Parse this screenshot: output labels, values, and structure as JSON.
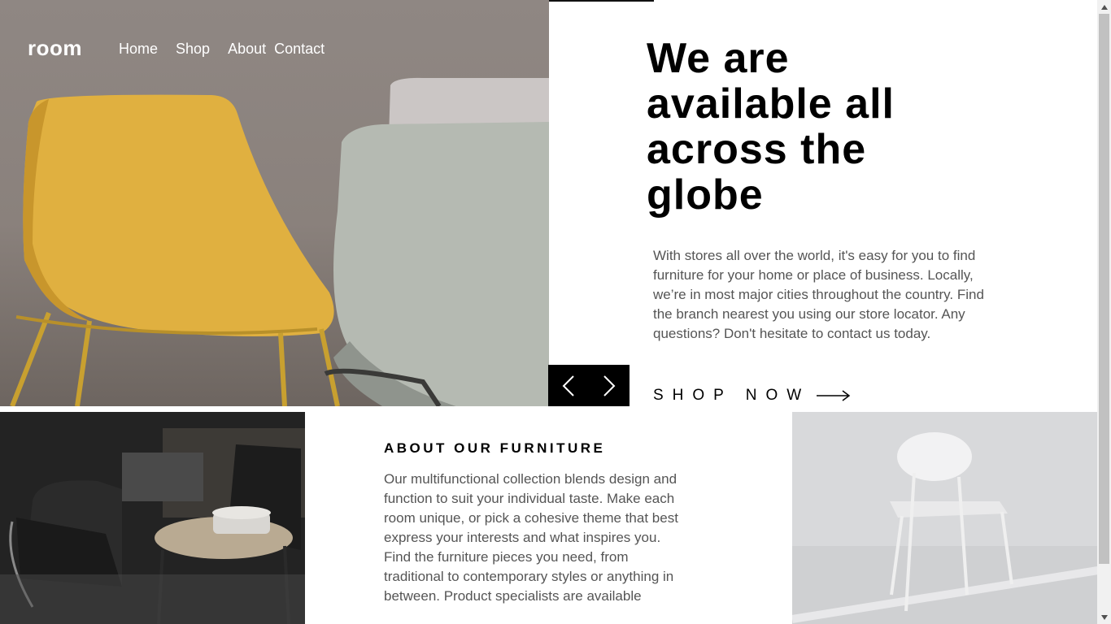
{
  "nav": {
    "logo": "room",
    "links": [
      {
        "label": "Home"
      },
      {
        "label": "Shop"
      },
      {
        "label": "About"
      },
      {
        "label": "Contact"
      }
    ]
  },
  "hero": {
    "title": "We are available all across the globe",
    "description": "With stores all over the world, it's easy for you to find furniture for your home or place of business. Locally, we’re in most major cities throughout the country. Find the branch nearest you using our store locator. Any questions? Don't hesitate to contact us today.",
    "cta_label": "SHOP NOW",
    "cta_icon": "long-arrow-right-icon",
    "slider": {
      "prev_icon": "chevron-left-icon",
      "next_icon": "chevron-right-icon"
    }
  },
  "about": {
    "title": "ABOUT OUR FURNITURE",
    "text": "Our multifunctional collection blends design and function to suit your individual taste. Make each room unique, or pick a cohesive theme that best express your interests and what inspires you. Find the furniture pieces you need, from traditional to contemporary styles or anything in between. Product specialists are available"
  },
  "colors": {
    "accent": "#d6336c",
    "text_dark": "#000000",
    "text_body": "#555555",
    "control_bg": "#000000"
  }
}
